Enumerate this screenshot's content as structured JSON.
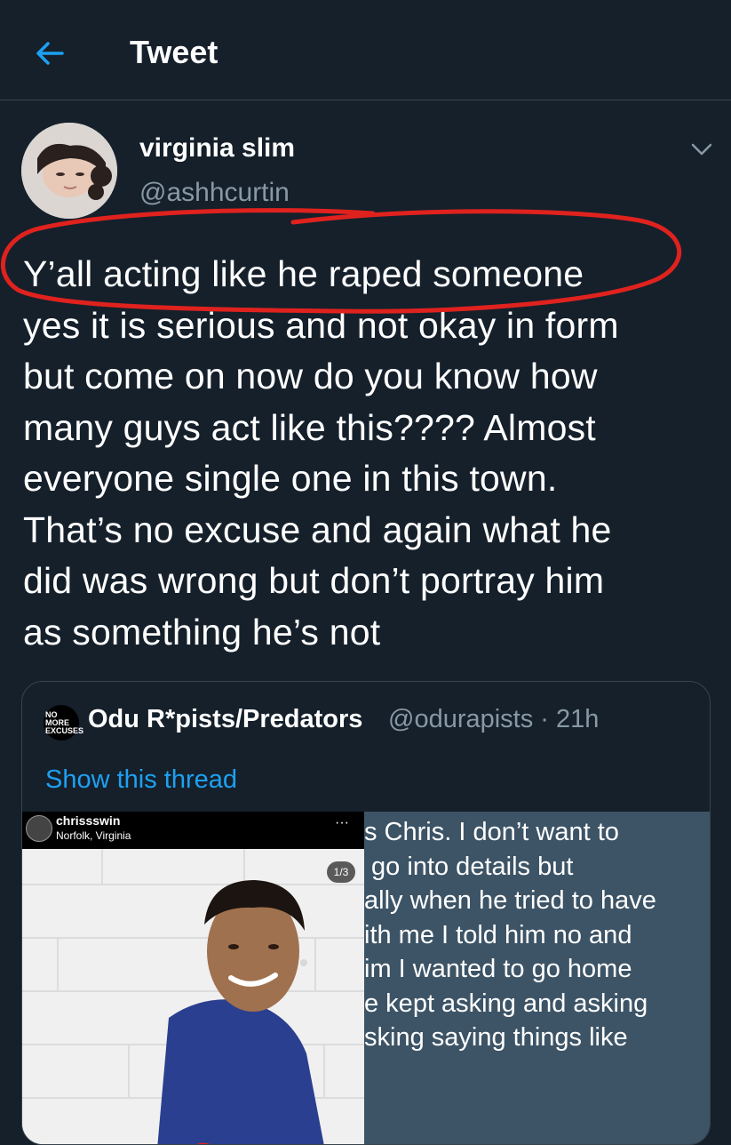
{
  "header": {
    "title": "Tweet"
  },
  "tweet": {
    "display_name": "virginia slim",
    "handle": "@ashhcurtin",
    "text": "Y’all acting like he raped someone\nyes it is serious and not okay in form\nbut come on now do you know how\nmany guys act like this???? Almost\neveryone single one in this town.\nThat’s no excuse and again what he\ndid was wrong but don’t portray him\nas something he’s not"
  },
  "quote": {
    "logo_text": "NO MORE EXCUSES",
    "name": "Odu R*pists/Predators",
    "meta": "@odurapists · 21h",
    "show_thread": "Show this thread",
    "instagram": {
      "username": "chrissswin",
      "location": "Norfolk, Virginia",
      "more": "···",
      "page_badge": "1/3"
    },
    "story_text": "s Chris. I don’t want to\n go into details but\nally when he tried to have\nith me I told him no and\nim I wanted to go home\ne kept asking and asking\nsking saying things like"
  },
  "colors": {
    "background": "#15202b",
    "secondary_text": "#8899a6",
    "link": "#1da1f2",
    "border": "#38444d",
    "annotation": "#e0221e"
  },
  "icons": {
    "back": "arrow-left-icon",
    "caret": "chevron-down-icon"
  }
}
